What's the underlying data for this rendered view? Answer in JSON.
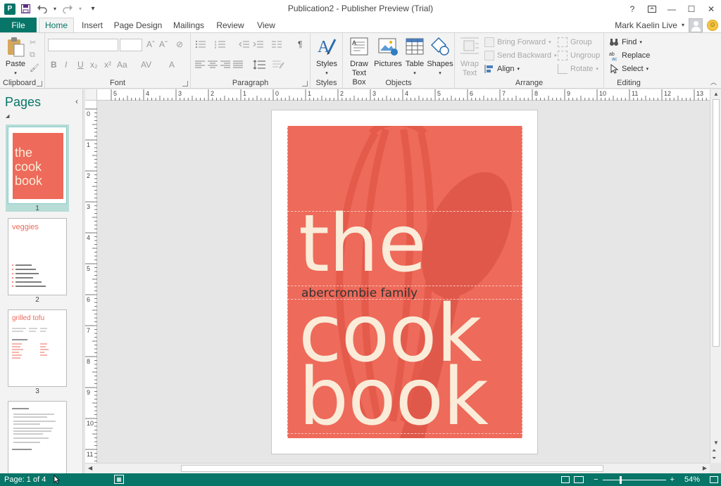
{
  "window": {
    "title": "Publication2 - Publisher Preview (Trial)",
    "help": "?",
    "minimize": "—",
    "maximize": "☐",
    "close": "✕"
  },
  "qat": {
    "app_icon": "P",
    "save_icon": "save-icon",
    "undo_icon": "undo-icon",
    "redo_icon": "redo-icon",
    "customize": "▾"
  },
  "tabs": {
    "file": "File",
    "items": [
      "Home",
      "Insert",
      "Page Design",
      "Mailings",
      "Review",
      "View"
    ],
    "active": "Home"
  },
  "user": {
    "name": "Mark Kaelin Live",
    "smiley": "☺"
  },
  "ribbon": {
    "clipboard": {
      "label": "Clipboard",
      "paste": "Paste"
    },
    "font": {
      "label": "Font",
      "bold": "B",
      "italic": "I",
      "underline": "U",
      "subscript": "x₂",
      "superscript": "x²",
      "change_case": "Aa",
      "grow": "Aˆ",
      "shrink": "Aˇ",
      "clear": "⊘",
      "spacing": "AV",
      "color": "A"
    },
    "paragraph": {
      "label": "Paragraph",
      "pilcrow": "¶"
    },
    "styles": {
      "label": "Styles",
      "button": "Styles"
    },
    "objects": {
      "label": "Objects",
      "draw_text_box": [
        "Draw",
        "Text Box"
      ],
      "pictures": "Pictures",
      "table": "Table",
      "shapes": "Shapes"
    },
    "arrange": {
      "label": "Arrange",
      "wrap_text": [
        "Wrap",
        "Text"
      ],
      "bring_forward": "Bring Forward",
      "send_backward": "Send Backward",
      "align": "Align",
      "group": "Group",
      "ungroup": "Ungroup",
      "rotate": "Rotate"
    },
    "editing": {
      "label": "Editing",
      "find": "Find",
      "replace": "Replace",
      "select": "Select"
    }
  },
  "pages_panel": {
    "title": "Pages",
    "pages": [
      {
        "number": "1",
        "preview_title": "the cook book"
      },
      {
        "number": "2",
        "preview_title": "veggies"
      },
      {
        "number": "3",
        "preview_title": "grilled tofu"
      },
      {
        "number": "4",
        "preview_title": ""
      }
    ]
  },
  "rulers": {
    "h_labels": [
      "5",
      "4",
      "3",
      "2",
      "1",
      "0",
      "1",
      "2",
      "3",
      "4",
      "5",
      "6",
      "7",
      "8",
      "9",
      "10",
      "11",
      "12",
      "13"
    ],
    "v_labels": [
      "0",
      "1",
      "2",
      "3",
      "4",
      "5",
      "6",
      "7",
      "8",
      "9",
      "10",
      "11"
    ]
  },
  "cover": {
    "word_the": "the",
    "family": "abercrombie family",
    "word_cook": "cook",
    "word_book": "book",
    "background_color": "#ee6a5a",
    "text_color": "#faecd9"
  },
  "status": {
    "page": "Page: 1 of 4",
    "zoom": "54%",
    "zoom_fraction": 0.54
  },
  "colors": {
    "accent": "#077568"
  }
}
